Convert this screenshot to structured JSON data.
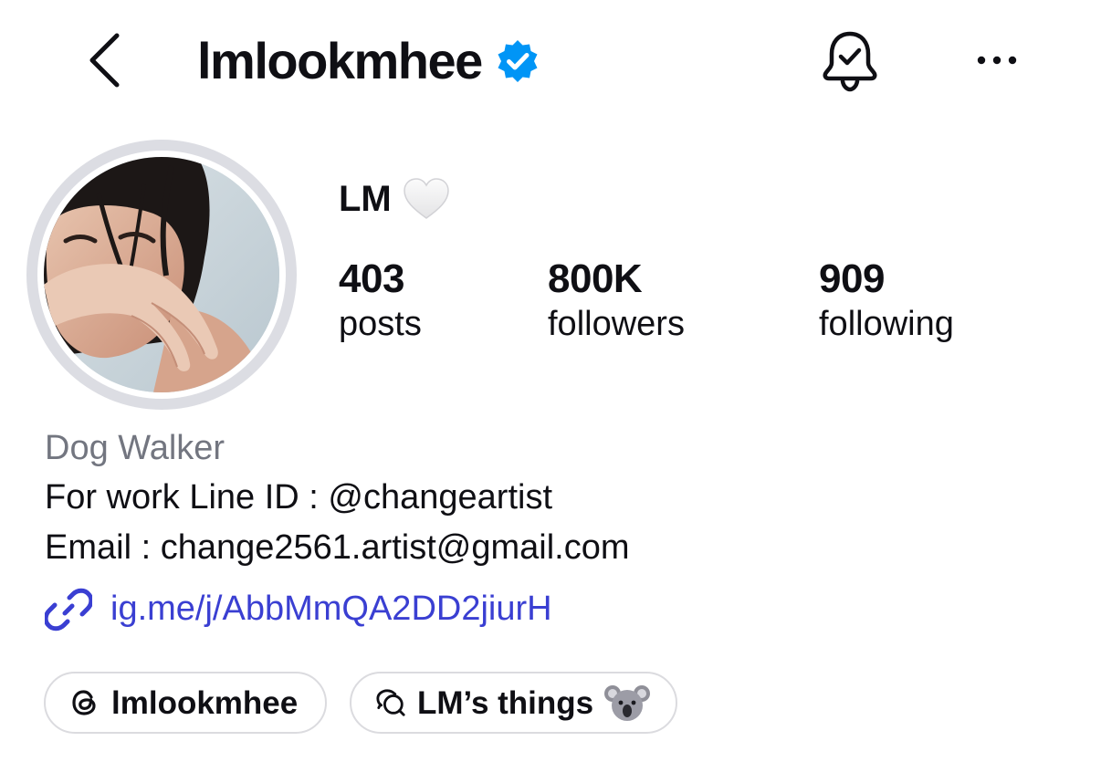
{
  "header": {
    "back_icon": "chevron-left-icon",
    "username": "lmlookmhee",
    "verified_icon": "verified-badge-icon",
    "verified_color": "#0095f6",
    "bell_icon": "bell-check-icon",
    "more_icon": "ellipsis-icon"
  },
  "profile": {
    "avatar": "profile-photo",
    "display_name": "LM",
    "name_emoji": "white-heart-icon",
    "stats": {
      "posts": {
        "value": "403",
        "label": "posts"
      },
      "followers": {
        "value": "800K",
        "label": "followers"
      },
      "following": {
        "value": "909",
        "label": "following"
      }
    }
  },
  "bio": {
    "category": "Dog Walker",
    "lines": [
      "For work Line ID : @changeartist",
      "Email : change2561.artist@gmail.com"
    ],
    "link_icon": "link-icon",
    "link": "ig.me/j/AbbMmQA2DD2jiurH",
    "link_color": "#3a3fd2"
  },
  "chips": [
    {
      "icon": "threads-icon",
      "label": "lmlookmhee"
    },
    {
      "icon": "broadcast-channel-icon",
      "label": "LM’s things",
      "emoji": "koala-icon"
    }
  ]
}
